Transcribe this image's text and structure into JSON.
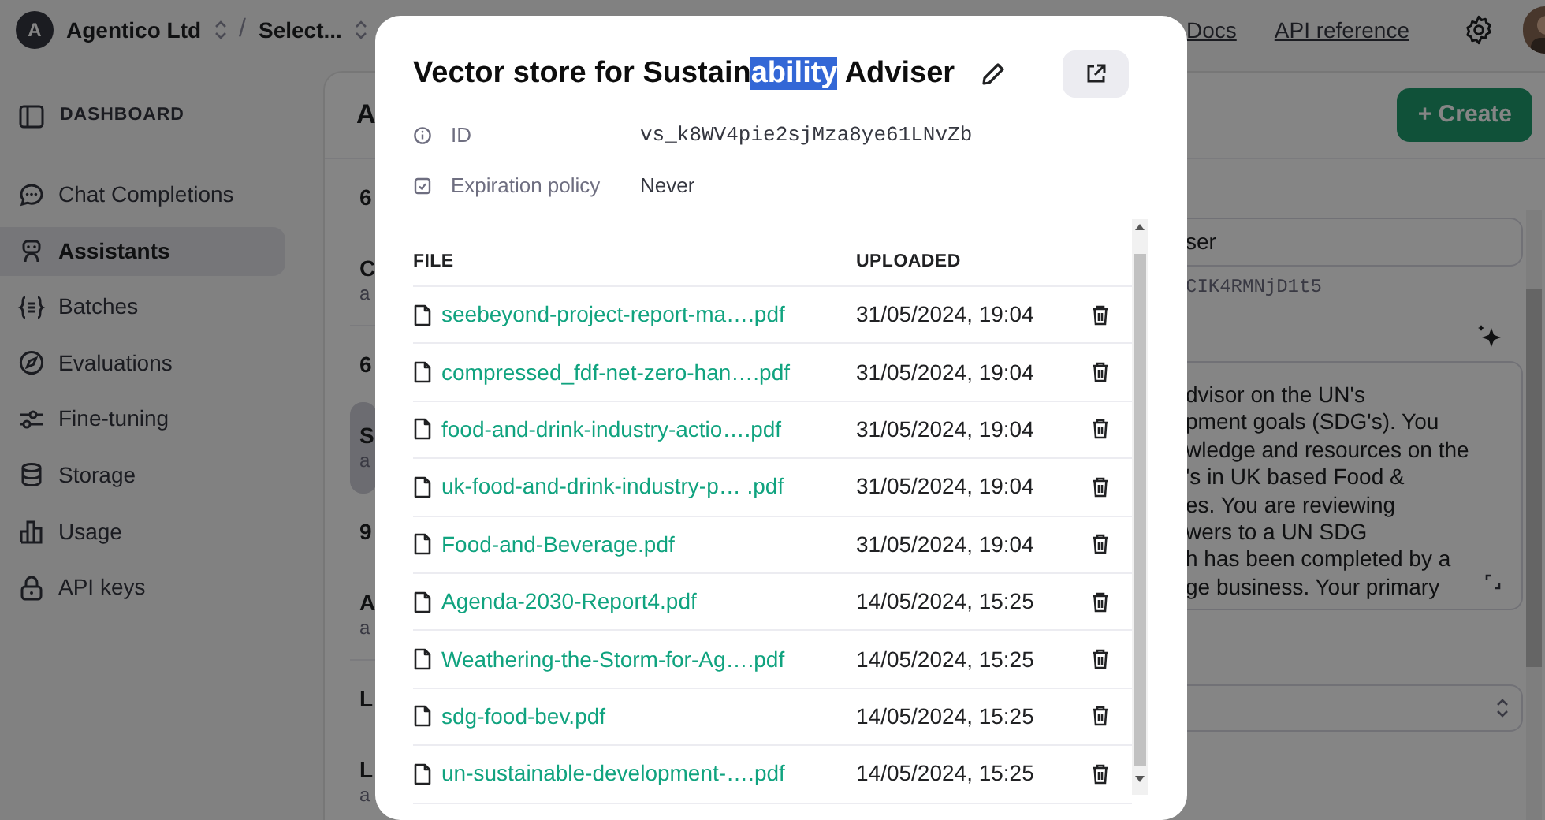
{
  "topbar": {
    "org_initial": "A",
    "org": "Agentico Ltd",
    "separator": "/",
    "project": "Select...",
    "links": [
      "Docs",
      "API reference"
    ]
  },
  "sidebar": {
    "heading": "DASHBOARD",
    "items": [
      {
        "label": "Chat Completions",
        "selected": false
      },
      {
        "label": "Assistants",
        "selected": true
      },
      {
        "label": "Batches",
        "selected": false
      },
      {
        "label": "Evaluations",
        "selected": false
      },
      {
        "label": "Fine-tuning",
        "selected": false
      },
      {
        "label": "Storage",
        "selected": false
      },
      {
        "label": "Usage",
        "selected": false
      },
      {
        "label": "API keys",
        "selected": false
      }
    ]
  },
  "main": {
    "heading": "A",
    "create_button": "+ Create",
    "list": [
      {
        "lines": [
          "6"
        ],
        "selected": false
      },
      {
        "lines": [
          "C",
          "a"
        ],
        "selected": false
      },
      {
        "lines": [
          "6"
        ],
        "selected": false
      },
      {
        "lines": [
          "S",
          "a"
        ],
        "selected": true
      },
      {
        "lines": [
          "9"
        ],
        "selected": false
      },
      {
        "lines": [
          "A",
          "a"
        ],
        "selected": false
      },
      {
        "lines": [
          "L"
        ],
        "selected": false
      },
      {
        "lines": [
          "L",
          "a"
        ],
        "selected": false
      }
    ],
    "detail": {
      "name_field": "ser",
      "id": "CIK4RMNjD1t5",
      "instructions_lines": [
        "dvisor on the UN's",
        "pment goals (SDG's). You",
        "wledge and resources on the",
        "'s in UK based Food &",
        "es. You are reviewing",
        "wers to a UN SDG",
        "h has been completed by a",
        "ge business. Your primary"
      ]
    }
  },
  "modal": {
    "title": [
      {
        "text": "Vector store for Sustain",
        "selected": false
      },
      {
        "text": "ability",
        "selected": true
      },
      {
        "text": " Adviser",
        "selected": false
      }
    ],
    "fields": [
      {
        "label": "ID",
        "value": "vs_k8WV4pie2sjMza8ye61LNvZb",
        "kind": "mono"
      },
      {
        "label": "Expiration policy",
        "value": "Never",
        "kind": "text"
      }
    ],
    "table": {
      "columns": [
        "FILE",
        "UPLOADED"
      ],
      "rows": [
        {
          "file": "seebeyond-project-report-ma….pdf",
          "uploaded": "31/05/2024, 19:04"
        },
        {
          "file": "compressed_fdf-net-zero-han….pdf",
          "uploaded": "31/05/2024, 19:04"
        },
        {
          "file": "food-and-drink-industry-actio….pdf",
          "uploaded": "31/05/2024, 19:04"
        },
        {
          "file": "uk-food-and-drink-industry-p… .pdf",
          "uploaded": "31/05/2024, 19:04"
        },
        {
          "file": "Food-and-Beverage.pdf",
          "uploaded": "31/05/2024, 19:04"
        },
        {
          "file": "Agenda-2030-Report4.pdf",
          "uploaded": "14/05/2024, 15:25"
        },
        {
          "file": "Weathering-the-Storm-for-Ag….pdf",
          "uploaded": "14/05/2024, 15:25"
        },
        {
          "file": "sdg-food-bev.pdf",
          "uploaded": "14/05/2024, 15:25"
        },
        {
          "file": "un-sustainable-development-….pdf",
          "uploaded": "14/05/2024, 15:25"
        }
      ]
    }
  }
}
